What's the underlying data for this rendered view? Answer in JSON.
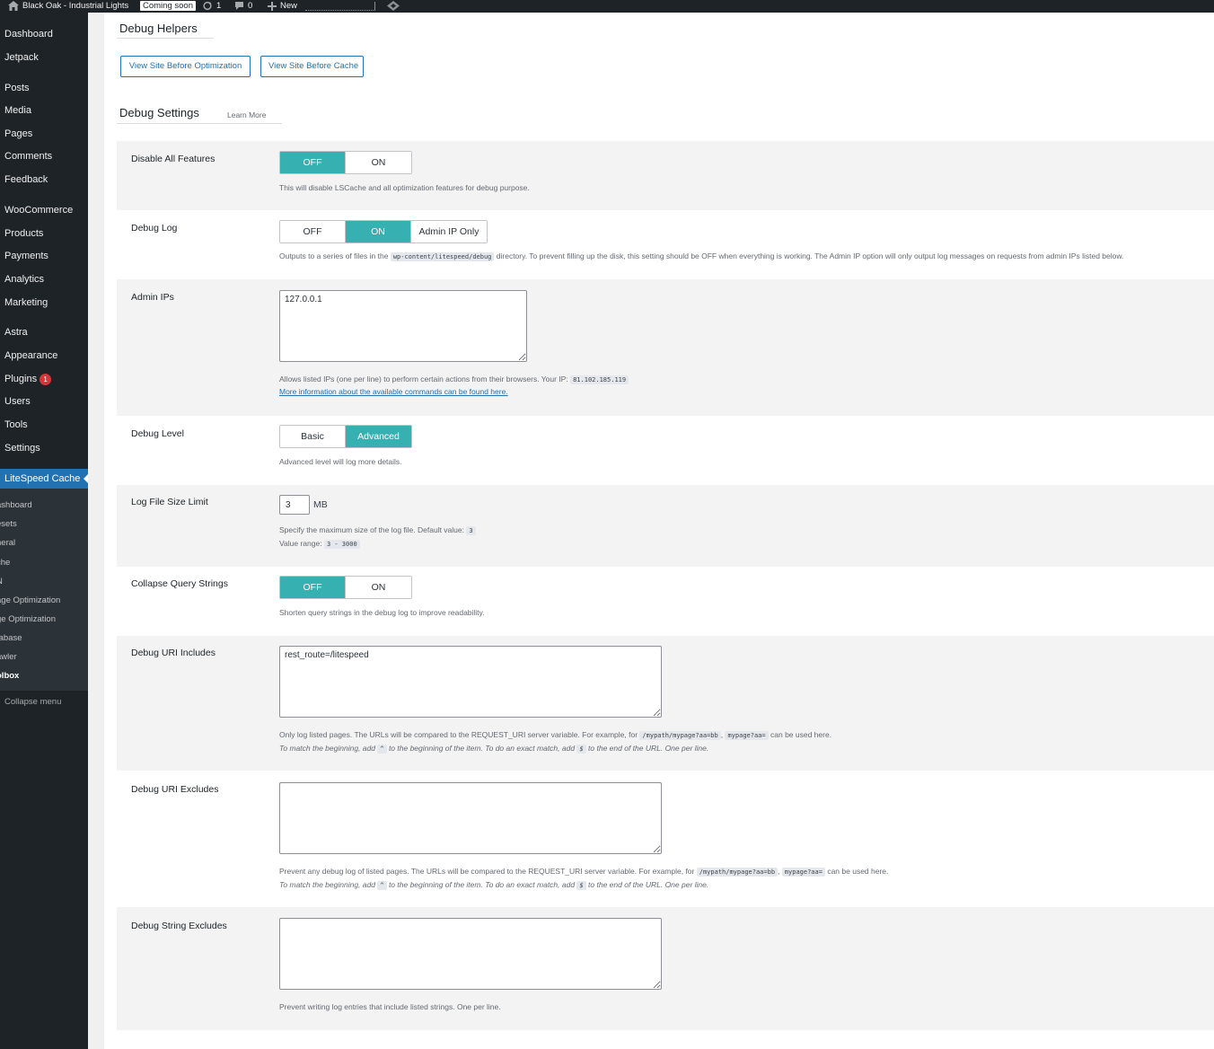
{
  "adminbar": {
    "site_name": "Black Oak - Industrial Lights",
    "coming_soon": "Coming soon",
    "updates_count": "1",
    "comments_count": "0",
    "new_label": "New"
  },
  "sidebar": {
    "items": [
      {
        "label": "Dashboard"
      },
      {
        "label": "Jetpack"
      },
      {
        "label": "Posts"
      },
      {
        "label": "Media"
      },
      {
        "label": "Pages"
      },
      {
        "label": "Comments"
      },
      {
        "label": "Feedback"
      },
      {
        "label": "WooCommerce"
      },
      {
        "label": "Products"
      },
      {
        "label": "Payments"
      },
      {
        "label": "Analytics"
      },
      {
        "label": "Marketing"
      },
      {
        "label": "Astra"
      },
      {
        "label": "Appearance"
      },
      {
        "label": "Plugins",
        "badge": "1"
      },
      {
        "label": "Users"
      },
      {
        "label": "Tools"
      },
      {
        "label": "Settings"
      }
    ],
    "current": "LiteSpeed Cache",
    "submenu": [
      "ashboard",
      "esets",
      "neral",
      "che",
      "N",
      "age Optimization",
      "ge Optimization",
      "tabase",
      "awler",
      "olbox"
    ],
    "collapse": "Collapse menu"
  },
  "debug_helpers": {
    "title": "Debug Helpers",
    "btn_before_optimization": "View Site Before Optimization",
    "btn_before_cache": "View Site Before Cache"
  },
  "debug_settings": {
    "title": "Debug Settings",
    "learn_more": "Learn More"
  },
  "disable_all": {
    "label": "Disable All Features",
    "off": "OFF",
    "on": "ON",
    "desc": "This will disable LSCache and all optimization features for debug purpose."
  },
  "debug_log": {
    "label": "Debug Log",
    "off": "OFF",
    "on": "ON",
    "admin_ip_only": "Admin IP Only",
    "desc_pre": "Outputs to a series of files in the",
    "desc_code": "wp-content/litespeed/debug",
    "desc_post": "directory. To prevent filling up the disk, this setting should be OFF when everything is working. The Admin IP option will only output log messages on requests from admin IPs listed below."
  },
  "admin_ips": {
    "label": "Admin IPs",
    "value": "127.0.0.1",
    "desc_pre": "Allows listed IPs (one per line) to perform certain actions from their browsers. Your IP:",
    "your_ip": "81.102.185.119",
    "link": "More information about the available commands can be found here."
  },
  "debug_level": {
    "label": "Debug Level",
    "basic": "Basic",
    "advanced": "Advanced",
    "desc": "Advanced level will log more details."
  },
  "log_size": {
    "label": "Log File Size Limit",
    "value": "3",
    "unit": "MB",
    "desc1_pre": "Specify the maximum size of the log file. Default value:",
    "default_value": "3",
    "desc2_pre": "Value range:",
    "range": "3 - 3000"
  },
  "collapse_qs": {
    "label": "Collapse Query Strings",
    "off": "OFF",
    "on": "ON",
    "desc": "Shorten query strings in the debug log to improve readability."
  },
  "uri_includes": {
    "label": "Debug URI Includes",
    "value": "rest_route=/litespeed",
    "desc1_pre": "Only log listed pages. The URLs will be compared to the REQUEST_URI server variable. For example, for",
    "code1": "/mypath/mypage?aa=bb",
    "comma": ",",
    "code2": "mypage?aa=",
    "desc1_post": "can be used here.",
    "desc2_a": "To match the beginning, add",
    "caret": "^",
    "desc2_b": "to the beginning of the item. To do an exact match, add",
    "dollar": "$",
    "desc2_c": "to the end of the URL. One per line."
  },
  "uri_excludes": {
    "label": "Debug URI Excludes",
    "value": "",
    "desc1_pre": "Prevent any debug log of listed pages. The URLs will be compared to the REQUEST_URI server variable. For example, for",
    "code1": "/mypath/mypage?aa=bb",
    "comma": ",",
    "code2": "mypage?aa=",
    "desc1_post": "can be used here.",
    "desc2_a": "To match the beginning, add",
    "caret": "^",
    "desc2_b": "to the beginning of the item. To do an exact match, add",
    "dollar": "$",
    "desc2_c": "to the end of the URL. One per line."
  },
  "string_excludes": {
    "label": "Debug String Excludes",
    "value": "",
    "desc": "Prevent writing log entries that include listed strings. One per line."
  },
  "colors": {
    "accent": "#36b0b0",
    "wp_blue": "#2271b1",
    "sidebar_bg": "#1d2327"
  }
}
